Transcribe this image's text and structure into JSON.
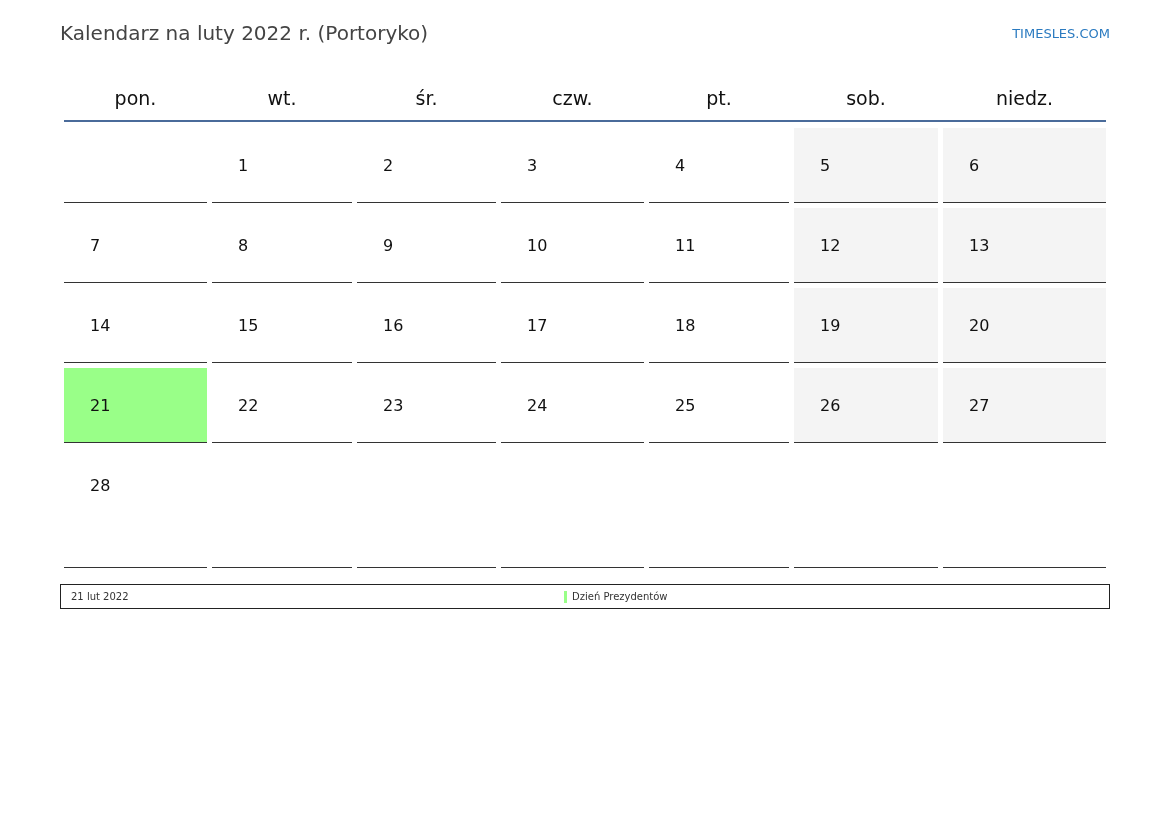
{
  "title": "Kalendarz na luty 2022 r. (Portoryko)",
  "site_link": "TIMESLES.COM",
  "weekdays": [
    "pon.",
    "wt.",
    "śr.",
    "czw.",
    "pt.",
    "sob.",
    "niedz."
  ],
  "weeks": [
    [
      {
        "kind": "blank"
      },
      {
        "kind": "weekday",
        "day": "1"
      },
      {
        "kind": "weekday",
        "day": "2"
      },
      {
        "kind": "weekday",
        "day": "3"
      },
      {
        "kind": "weekday",
        "day": "4"
      },
      {
        "kind": "weekend",
        "day": "5"
      },
      {
        "kind": "weekend",
        "day": "6"
      }
    ],
    [
      {
        "kind": "weekday",
        "day": "7"
      },
      {
        "kind": "weekday",
        "day": "8"
      },
      {
        "kind": "weekday",
        "day": "9"
      },
      {
        "kind": "weekday",
        "day": "10"
      },
      {
        "kind": "weekday",
        "day": "11"
      },
      {
        "kind": "weekend",
        "day": "12"
      },
      {
        "kind": "weekend",
        "day": "13"
      }
    ],
    [
      {
        "kind": "weekday",
        "day": "14"
      },
      {
        "kind": "weekday",
        "day": "15"
      },
      {
        "kind": "weekday",
        "day": "16"
      },
      {
        "kind": "weekday",
        "day": "17"
      },
      {
        "kind": "weekday",
        "day": "18"
      },
      {
        "kind": "weekend",
        "day": "19"
      },
      {
        "kind": "weekend",
        "day": "20"
      }
    ],
    [
      {
        "kind": "holiday",
        "day": "21"
      },
      {
        "kind": "weekday",
        "day": "22"
      },
      {
        "kind": "weekday",
        "day": "23"
      },
      {
        "kind": "weekday",
        "day": "24"
      },
      {
        "kind": "weekday",
        "day": "25"
      },
      {
        "kind": "weekend",
        "day": "26"
      },
      {
        "kind": "weekend",
        "day": "27"
      }
    ],
    [
      {
        "kind": "weekday",
        "day": "28"
      },
      {
        "kind": "blank"
      },
      {
        "kind": "blank"
      },
      {
        "kind": "blank"
      },
      {
        "kind": "blank"
      },
      {
        "kind": "blank"
      },
      {
        "kind": "blank"
      }
    ]
  ],
  "events": [
    {
      "date": "21 lut 2022",
      "name": "Dzień Prezydentów",
      "color": "#99ff88"
    }
  ]
}
